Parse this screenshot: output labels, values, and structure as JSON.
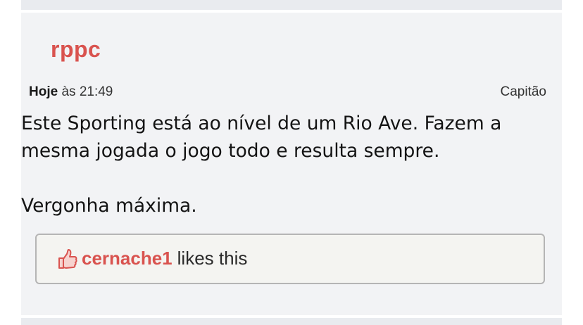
{
  "post": {
    "username": "rppc",
    "date_day": "Hoje",
    "date_time": "às 21:49",
    "user_title": "Capitão",
    "message_lines": [
      "Este Sporting está ao nível de um Rio Ave. Fazem a",
      "mesma jogada o jogo todo e resulta sempre.",
      "Vergonha máxima."
    ],
    "likes": {
      "user": "cernache1",
      "suffix": "likes this",
      "icon": "thumbs-up-icon"
    }
  },
  "colors": {
    "accent": "#d9534f",
    "post_background": "#f2f3f5",
    "likes_background": "#f4f4f1"
  }
}
